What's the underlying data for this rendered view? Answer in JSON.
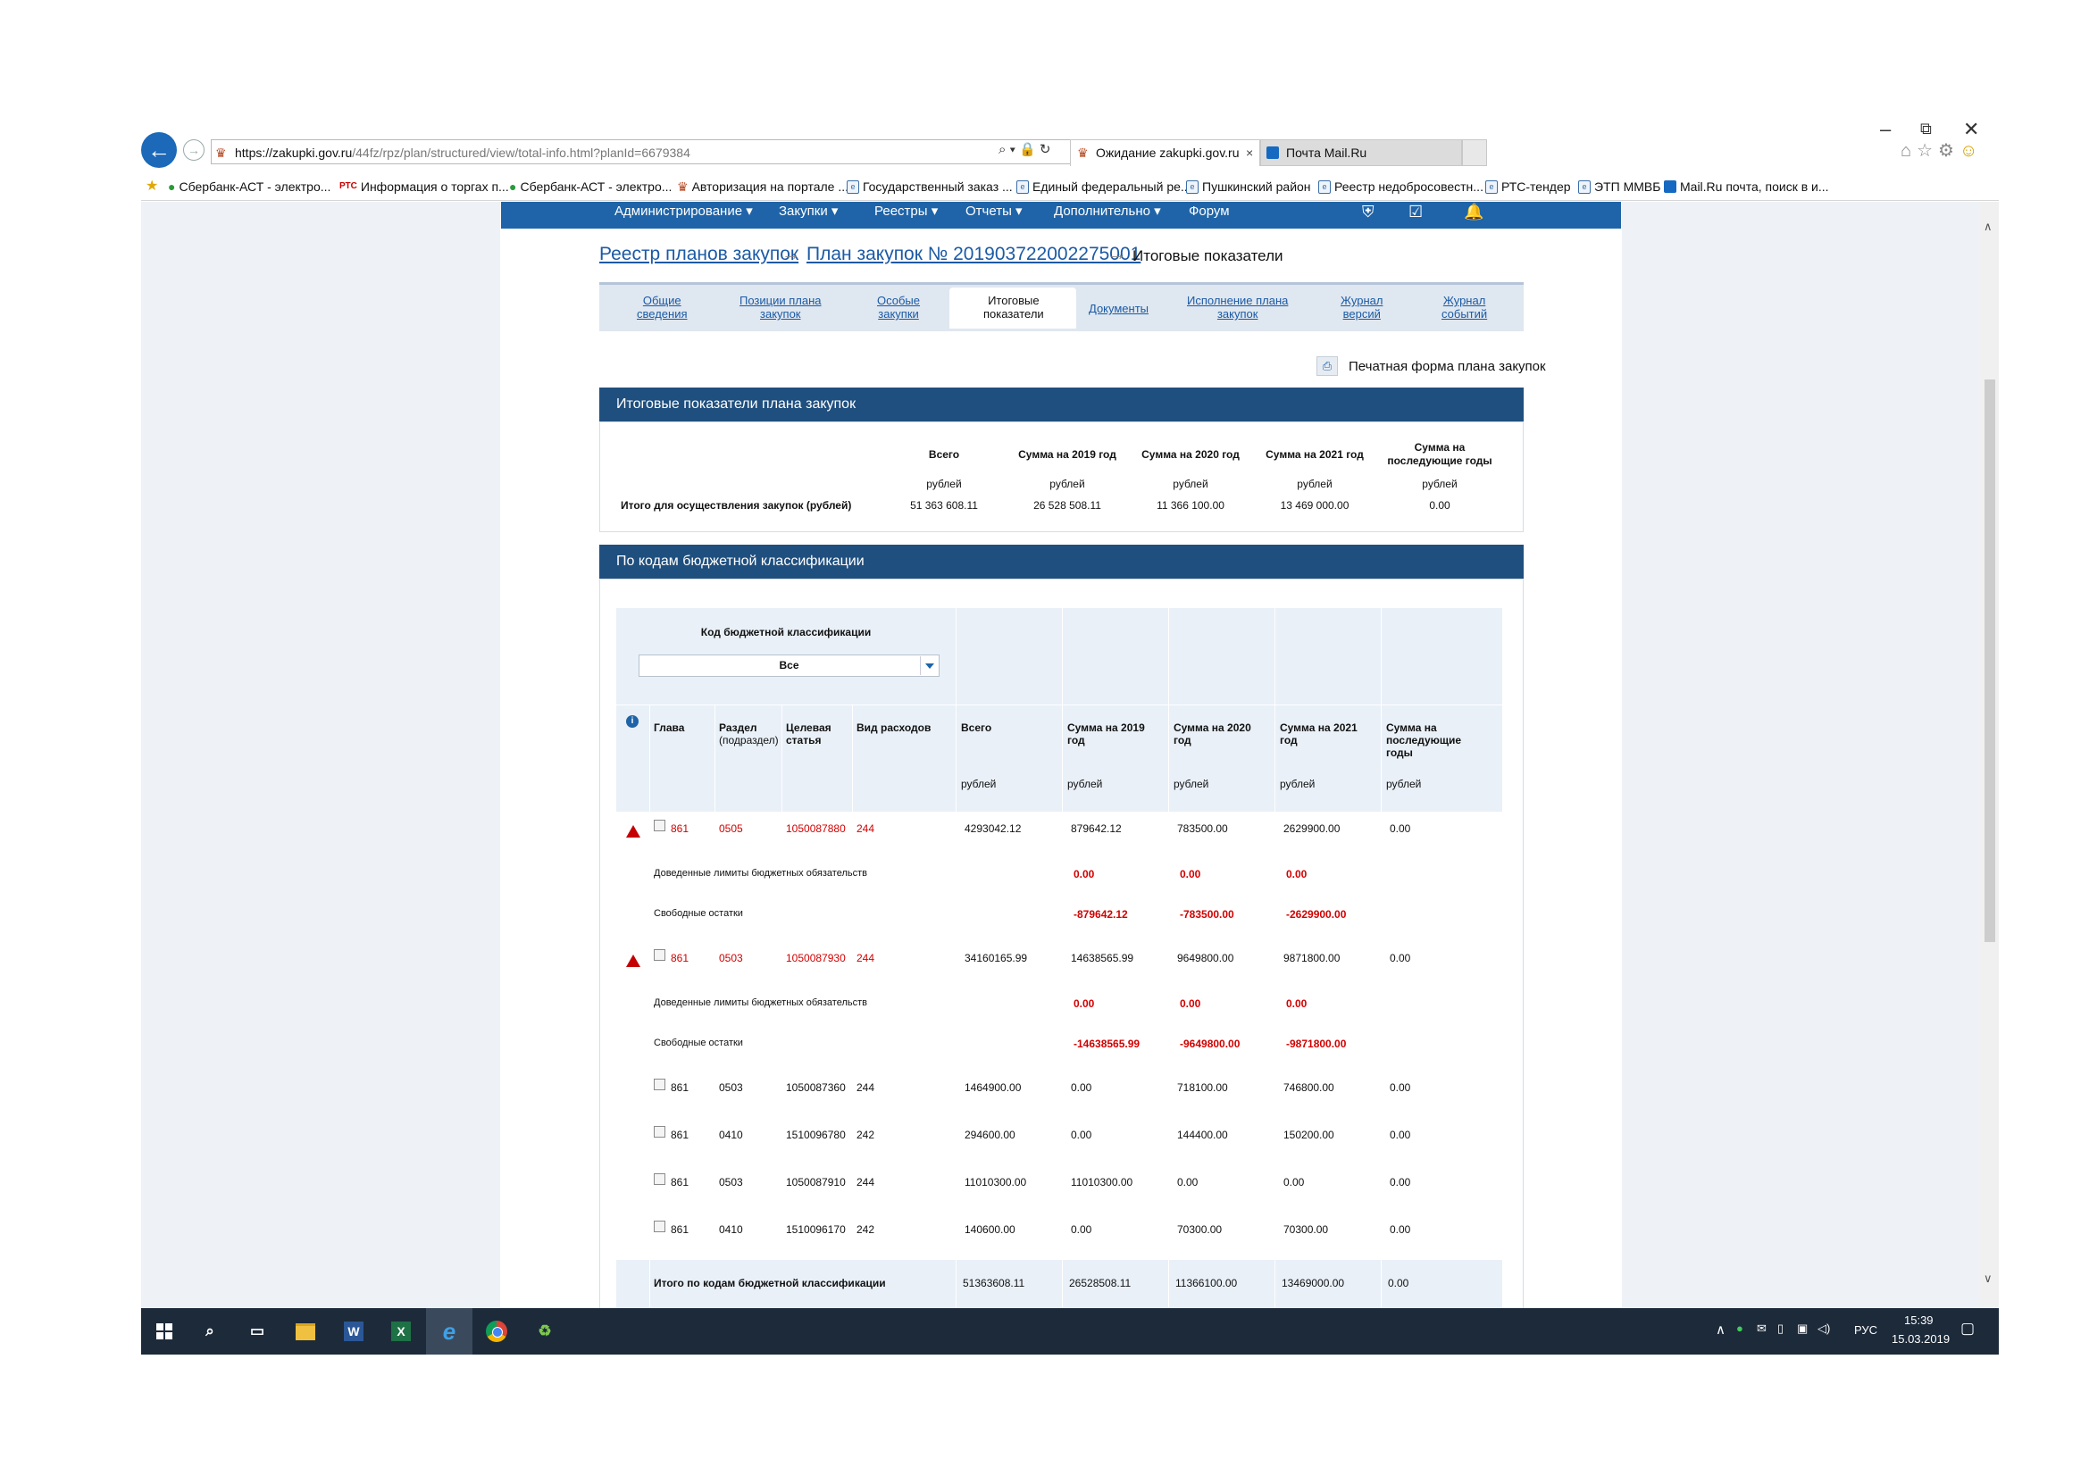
{
  "browser": {
    "address_main": "https://zakupki.gov.ru",
    "address_rest": "/44fz/rpz/plan/structured/view/total-info.html?planId=6679384",
    "search_glyph": "⌕ ▾ 🔒 ↻",
    "tabs": [
      {
        "label": "Ожидание zakupki.gov.ru"
      },
      {
        "label": "Почта Mail.Ru"
      }
    ],
    "favorites": [
      "Сбербанк-АСТ - электро...",
      "Информация о торгах п...",
      "Сбербанк-АСТ - электро...",
      "Авторизация на портале ...",
      "Государственный заказ ...",
      "Единый федеральный ре...",
      "Пушкинский район",
      "Реестр недобросовестн...",
      "РТС-тендер",
      "ЭТП ММВБ",
      "Mail.Ru почта, поиск в и..."
    ],
    "rts_badge": "РТС"
  },
  "topmenu": [
    "Администрирование ▾",
    "Закупки ▾",
    "Реестры ▾",
    "Отчеты ▾",
    "Дополнительно ▾",
    "Форум"
  ],
  "breadcrumb": {
    "item1": "Реестр планов закупок",
    "item2": "План закупок № 201903722002275001",
    "item3": "Итоговые показатели"
  },
  "page_tabs": [
    {
      "l1": "Общие",
      "l2": "сведения"
    },
    {
      "l1": "Позиции плана",
      "l2": "закупок"
    },
    {
      "l1": "Особые",
      "l2": "закупки"
    },
    {
      "l1": "Итоговые",
      "l2": "показатели"
    },
    {
      "l1": "Документы",
      "l2": ""
    },
    {
      "l1": "Исполнение плана",
      "l2": "закупок"
    },
    {
      "l1": "Журнал",
      "l2": "версий"
    },
    {
      "l1": "Журнал",
      "l2": "событий"
    }
  ],
  "print_link": "Печатная форма плана закупок",
  "summary": {
    "title": "Итоговые показатели плана закупок",
    "col_headers": [
      "Всего",
      "Сумма на 2019 год",
      "Сумма на 2020 год",
      "Сумма на 2021 год",
      "Сумма на последующие годы"
    ],
    "unit": "рублей",
    "row_label": "Итого для осуществления закупок (рублей)",
    "values": [
      "51 363 608.11",
      "26 528 508.11",
      "11 366 100.00",
      "13 469 000.00",
      "0.00"
    ]
  },
  "kbk": {
    "title": "По кодам бюджетной классификации",
    "filter_label": "Код бюджетной классификации",
    "filter_value": "Все",
    "headers": {
      "glava": "Глава",
      "razdel1": "Раздел",
      "razdel2": "(подраздел)",
      "celevaya1": "Целевая",
      "celevaya2": "статья",
      "vid": "Вид расходов",
      "vsego": "Всего",
      "y2019_1": "Сумма на 2019",
      "y2019_2": "год",
      "y2020_1": "Сумма на 2020",
      "y2020_2": "год",
      "y2021_1": "Сумма на 2021",
      "y2021_2": "год",
      "next1": "Сумма на",
      "next2": "последующие",
      "next3": "годы",
      "unit": "рублей"
    },
    "limits_label": "Доведенные лимиты бюджетных обязательств",
    "free_label": "Свободные остатки",
    "rows": [
      {
        "glava": "861",
        "razdel": "0505",
        "cs": "1050087880",
        "vid": "244",
        "total": "4293042.12",
        "y2019": "879642.12",
        "y2020": "783500.00",
        "y2021": "2629900.00",
        "next": "0.00",
        "lim2019": "0.00",
        "lim2020": "0.00",
        "lim2021": "0.00",
        "free2019": "-879642.12",
        "free2020": "-783500.00",
        "free2021": "-2629900.00"
      },
      {
        "glava": "861",
        "razdel": "0503",
        "cs": "1050087930",
        "vid": "244",
        "total": "34160165.99",
        "y2019": "14638565.99",
        "y2020": "9649800.00",
        "y2021": "9871800.00",
        "next": "0.00",
        "lim2019": "0.00",
        "lim2020": "0.00",
        "lim2021": "0.00",
        "free2019": "-14638565.99",
        "free2020": "-9649800.00",
        "free2021": "-9871800.00"
      },
      {
        "glava": "861",
        "razdel": "0503",
        "cs": "1050087360",
        "vid": "244",
        "total": "1464900.00",
        "y2019": "0.00",
        "y2020": "718100.00",
        "y2021": "746800.00",
        "next": "0.00"
      },
      {
        "glava": "861",
        "razdel": "0410",
        "cs": "1510096780",
        "vid": "242",
        "total": "294600.00",
        "y2019": "0.00",
        "y2020": "144400.00",
        "y2021": "150200.00",
        "next": "0.00"
      },
      {
        "glava": "861",
        "razdel": "0503",
        "cs": "1050087910",
        "vid": "244",
        "total": "11010300.00",
        "y2019": "11010300.00",
        "y2020": "0.00",
        "y2021": "0.00",
        "next": "0.00"
      },
      {
        "glava": "861",
        "razdel": "0410",
        "cs": "1510096170",
        "vid": "242",
        "total": "140600.00",
        "y2019": "0.00",
        "y2020": "70300.00",
        "y2021": "70300.00",
        "next": "0.00"
      }
    ],
    "total": {
      "label": "Итого по кодам бюджетной классификации",
      "total": "51363608.11",
      "y2019": "26528508.11",
      "y2020": "11366100.00",
      "y2021": "13469000.00",
      "next": "0.00"
    }
  },
  "taskbar": {
    "lang": "РУС",
    "time": "15:39",
    "date": "15.03.2019",
    "apps": [
      "W",
      "X"
    ]
  }
}
